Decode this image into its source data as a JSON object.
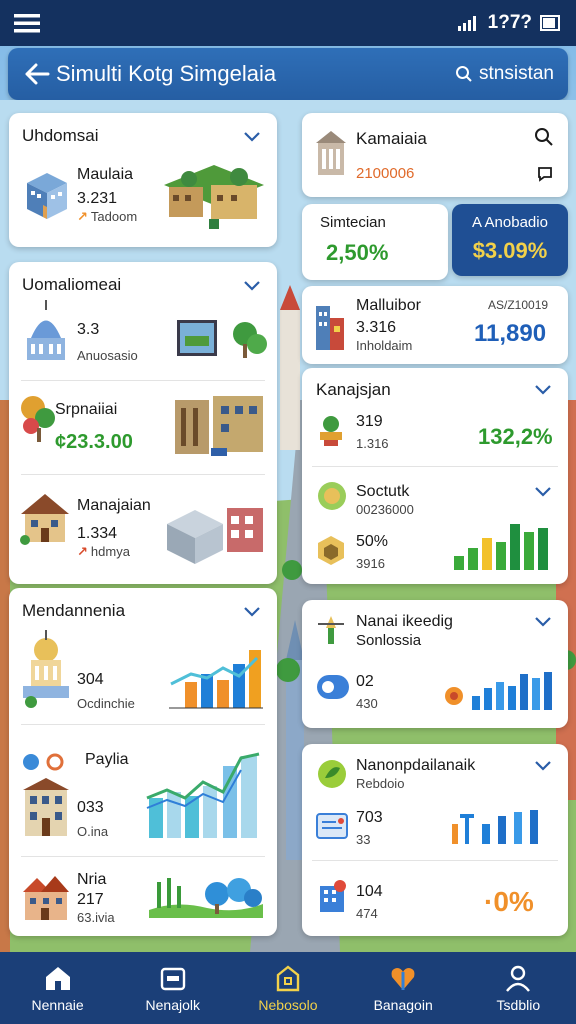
{
  "status": {
    "time": "1?7?"
  },
  "header": {
    "title": "Simulti Kotg Simgelaia",
    "search_label": "stnsistan"
  },
  "left": {
    "card1": {
      "title": "Uhdomsai",
      "item": {
        "name": "Maulaia",
        "value": "3.231",
        "sub": "Tadoom"
      }
    },
    "card2": {
      "title": "Uomaliomeai",
      "items": [
        {
          "name": "3.3",
          "sub": "Anuosasio"
        },
        {
          "name": "Srpnaiiai",
          "value": "¢23.3.00"
        },
        {
          "name": "Manajaian",
          "value": "1.334",
          "sub": "hdmya"
        }
      ]
    },
    "card3": {
      "title": "Mendannenia",
      "items": [
        {
          "value": "304",
          "sub": "Ocdinchie"
        },
        {
          "name": "Paylia",
          "value": "033",
          "sub": "O.ina"
        },
        {
          "name": "Nria",
          "value": "217",
          "sub": "63.ivia"
        }
      ]
    }
  },
  "right": {
    "card1": {
      "title": "Kamaiaia",
      "value": "2100006"
    },
    "stats": [
      {
        "label": "Simtecian",
        "value": "2,50%"
      },
      {
        "label": "A Anobadio",
        "value": "$3.09%"
      }
    ],
    "card2": {
      "name": "Malluibor",
      "value": "3.316",
      "sub": "Inholdaim",
      "date": "AS/Z10019",
      "big": "11,890"
    },
    "card3": {
      "title": "Kanajsjan",
      "items": [
        {
          "value": "319",
          "sub": "1.316",
          "big": "132,2%"
        },
        {
          "name": "Soctutk",
          "sub": "00236000"
        },
        {
          "value": "50%",
          "sub": "3916"
        }
      ]
    },
    "card4": {
      "title": "Nanai ikeedig",
      "subtitle": "Sonlossia",
      "value": "02",
      "sub": "430"
    },
    "card5": {
      "title": "Nanonpdailanaik",
      "subtitle": "Rebdoio",
      "item1": {
        "value": "703",
        "sub": "33"
      },
      "item2": {
        "value": "104",
        "sub": "474",
        "big": "·0%"
      }
    }
  },
  "nav": {
    "items": [
      {
        "label": "Nennaie"
      },
      {
        "label": "Nenajolk"
      },
      {
        "label": "Nebosolo"
      },
      {
        "label": "Banagoin"
      },
      {
        "label": "Tsdblio"
      }
    ]
  },
  "colors": {
    "nav_bg": "#1b3f78",
    "active": "#f2d14a",
    "green": "#2e9a2e",
    "blue": "#1f5fb8",
    "orange": "#f0902a"
  }
}
